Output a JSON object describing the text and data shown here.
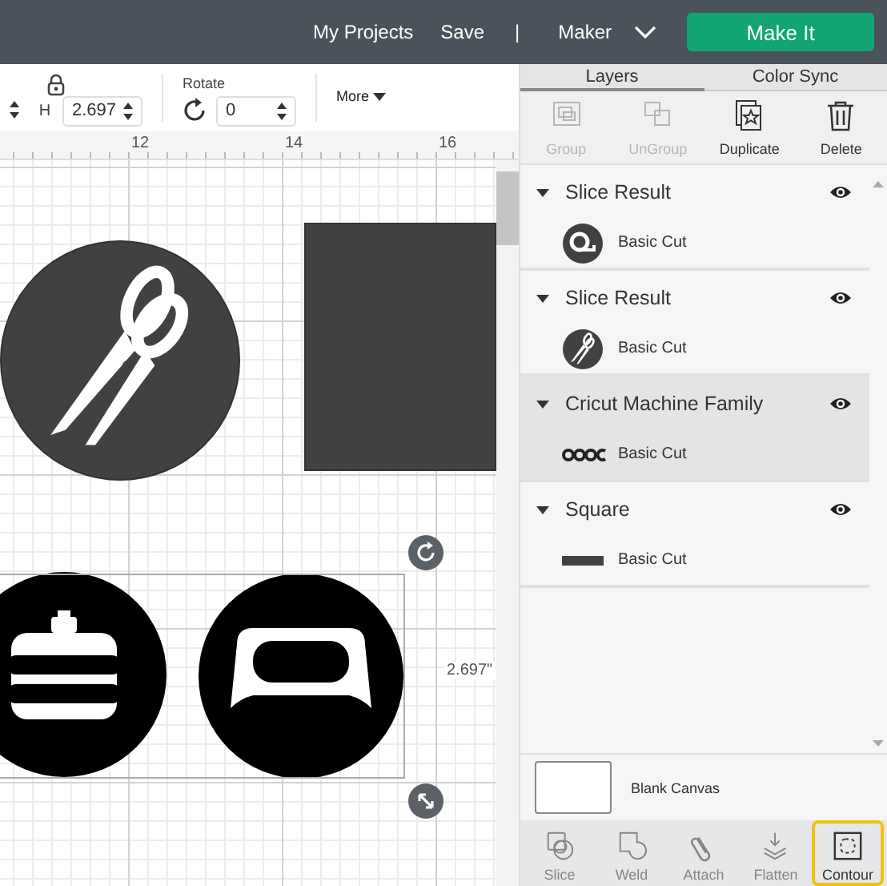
{
  "top_bar": {
    "links": [
      "My Projects",
      "Save"
    ],
    "separator": "|",
    "machine": "Maker",
    "primary_button": "Make It"
  },
  "toolbar": {
    "height_label": "H",
    "height_value": "2.697",
    "rotate_label": "Rotate",
    "rotate_value": "0",
    "more": "More"
  },
  "ruler": {
    "ticks": [
      "12",
      "14",
      "16"
    ]
  },
  "canvas": {
    "dimension_label": "2.697\""
  },
  "panel": {
    "tabs": [
      {
        "label": "Layers",
        "selected": true
      },
      {
        "label": "Color Sync",
        "selected": false
      }
    ],
    "actions": [
      {
        "label": "Group",
        "kind": "group",
        "disabled": true
      },
      {
        "label": "UnGroup",
        "kind": "ungroup",
        "disabled": true
      },
      {
        "label": "Duplicate",
        "kind": "duplicate",
        "disabled": false
      },
      {
        "label": "Delete",
        "kind": "delete",
        "disabled": false
      }
    ],
    "layers": [
      {
        "name": "Slice Result",
        "expanded": true,
        "selected": false,
        "visible": true,
        "children": [
          {
            "label": "Basic Cut",
            "kind": "tape"
          }
        ]
      },
      {
        "name": "Slice Result",
        "expanded": true,
        "selected": false,
        "visible": true,
        "children": [
          {
            "label": "Basic Cut",
            "kind": "scissors"
          }
        ]
      },
      {
        "name": "Cricut Machine Family",
        "expanded": true,
        "selected": true,
        "visible": true,
        "children": [
          {
            "label": "Basic Cut",
            "kind": "dots"
          }
        ]
      },
      {
        "name": "Square",
        "expanded": true,
        "selected": false,
        "visible": true,
        "children": [
          {
            "label": "Basic Cut",
            "kind": "bar"
          }
        ]
      }
    ],
    "blank_canvas": "Blank Canvas",
    "tools": [
      {
        "label": "Slice",
        "kind": "slice",
        "disabled": true,
        "highlighted": false
      },
      {
        "label": "Weld",
        "kind": "weld",
        "disabled": true,
        "highlighted": false
      },
      {
        "label": "Attach",
        "kind": "attach",
        "disabled": true,
        "highlighted": false
      },
      {
        "label": "Flatten",
        "kind": "flatten",
        "disabled": true,
        "highlighted": false
      },
      {
        "label": "Contour",
        "kind": "contour",
        "disabled": false,
        "highlighted": true
      }
    ]
  }
}
